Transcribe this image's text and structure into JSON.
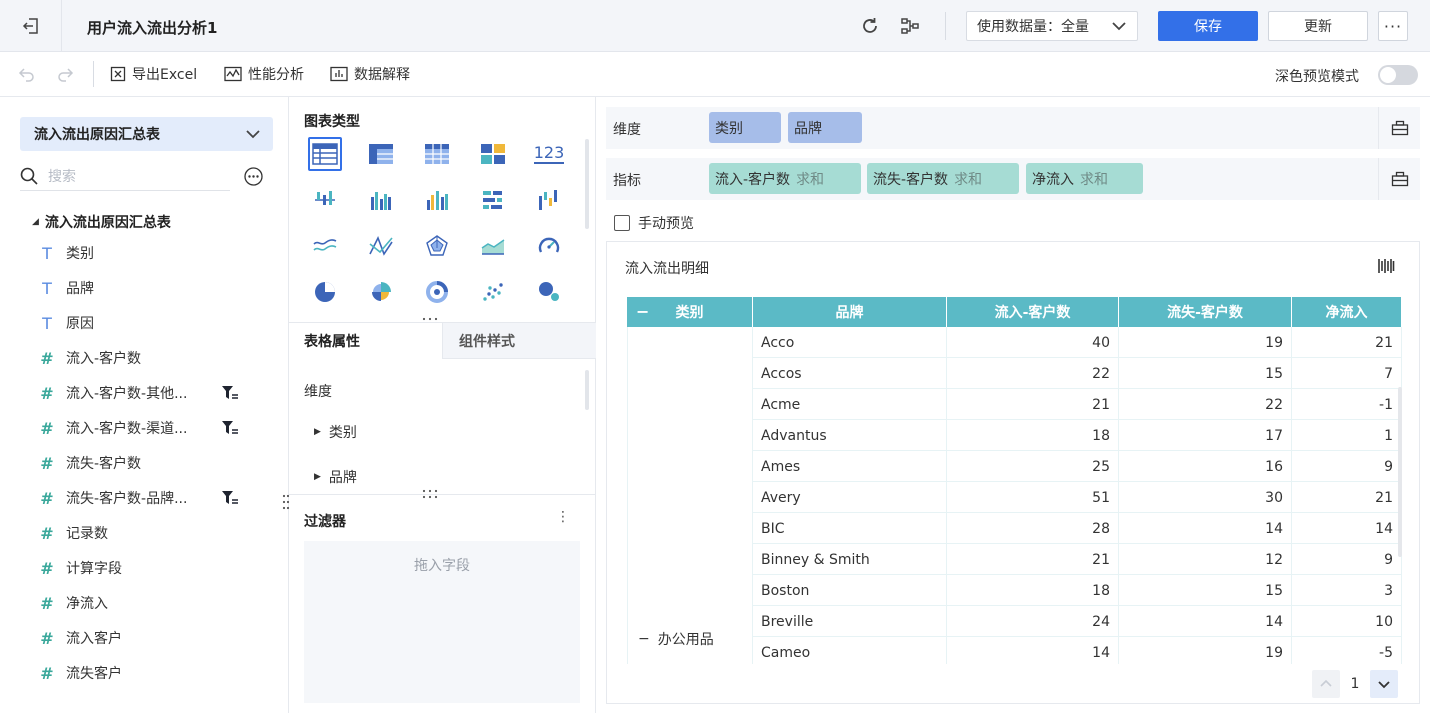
{
  "header": {
    "title": "用户流入流出分析1",
    "data_amount_label": "使用数据量：全量",
    "save_label": "保存",
    "update_label": "更新",
    "more_label": "···"
  },
  "toolbar": {
    "export_excel": "导出Excel",
    "performance": "性能分析",
    "data_explain": "数据解释",
    "dark_preview": "深色预览模式"
  },
  "left": {
    "dataset": "流入流出原因汇总表",
    "search_placeholder": "搜索",
    "tree_root": "流入流出原因汇总表",
    "fields": [
      {
        "label": "类别",
        "icon": "T"
      },
      {
        "label": "品牌",
        "icon": "T"
      },
      {
        "label": "原因",
        "icon": "T"
      },
      {
        "label": "流入-客户数",
        "icon": "#"
      },
      {
        "label": "流入-客户数-其他...",
        "icon": "#"
      },
      {
        "label": "流入-客户数-渠道...",
        "icon": "#"
      },
      {
        "label": "流失-客户数",
        "icon": "#"
      },
      {
        "label": "流失-客户数-品牌...",
        "icon": "#"
      },
      {
        "label": "记录数",
        "icon": "#"
      },
      {
        "label": "计算字段",
        "icon": "#"
      },
      {
        "label": "净流入",
        "icon": "#"
      },
      {
        "label": "流入客户",
        "icon": "#"
      },
      {
        "label": "流失客户",
        "icon": "#"
      }
    ]
  },
  "middle": {
    "chart_type_title": "图表类型",
    "tab_table_props": "表格属性",
    "tab_component_style": "组件样式",
    "dimension_title": "维度",
    "dim_items": [
      "类别",
      "品牌"
    ],
    "filter_title": "过滤器",
    "drop_hint": "拖入字段",
    "number_icon": "123"
  },
  "right": {
    "dimension_label": "维度",
    "dimension_pills": [
      "类别",
      "品牌"
    ],
    "measure_label": "指标",
    "measure_pills": [
      {
        "name": "流入-客户数",
        "agg": "求和"
      },
      {
        "name": "流失-客户数",
        "agg": "求和"
      },
      {
        "name": "净流入",
        "agg": "求和"
      }
    ],
    "manual_preview": "手动预览",
    "preview_title": "流入流出明细",
    "table": {
      "headers": [
        "类别",
        "品牌",
        "流入-客户数",
        "流失-客户数",
        "净流入"
      ],
      "group_label": "办公用品",
      "rows": [
        {
          "brand": "Acco",
          "in": "40",
          "out": "19",
          "net": "21"
        },
        {
          "brand": "Accos",
          "in": "22",
          "out": "15",
          "net": "7"
        },
        {
          "brand": "Acme",
          "in": "21",
          "out": "22",
          "net": "-1"
        },
        {
          "brand": "Advantus",
          "in": "18",
          "out": "17",
          "net": "1"
        },
        {
          "brand": "Ames",
          "in": "25",
          "out": "16",
          "net": "9"
        },
        {
          "brand": "Avery",
          "in": "51",
          "out": "30",
          "net": "21"
        },
        {
          "brand": "BIC",
          "in": "28",
          "out": "14",
          "net": "14"
        },
        {
          "brand": "Binney & Smith",
          "in": "21",
          "out": "12",
          "net": "9"
        },
        {
          "brand": "Boston",
          "in": "18",
          "out": "15",
          "net": "3"
        },
        {
          "brand": "Breville",
          "in": "24",
          "out": "14",
          "net": "10"
        },
        {
          "brand": "Cameo",
          "in": "14",
          "out": "19",
          "net": "-5"
        }
      ]
    },
    "page": "1"
  },
  "colors": {
    "primary": "#3370e8",
    "table_header": "#5bbac6",
    "dim_pill": "#a6bde9",
    "measure_pill": "#a6dcd4"
  }
}
